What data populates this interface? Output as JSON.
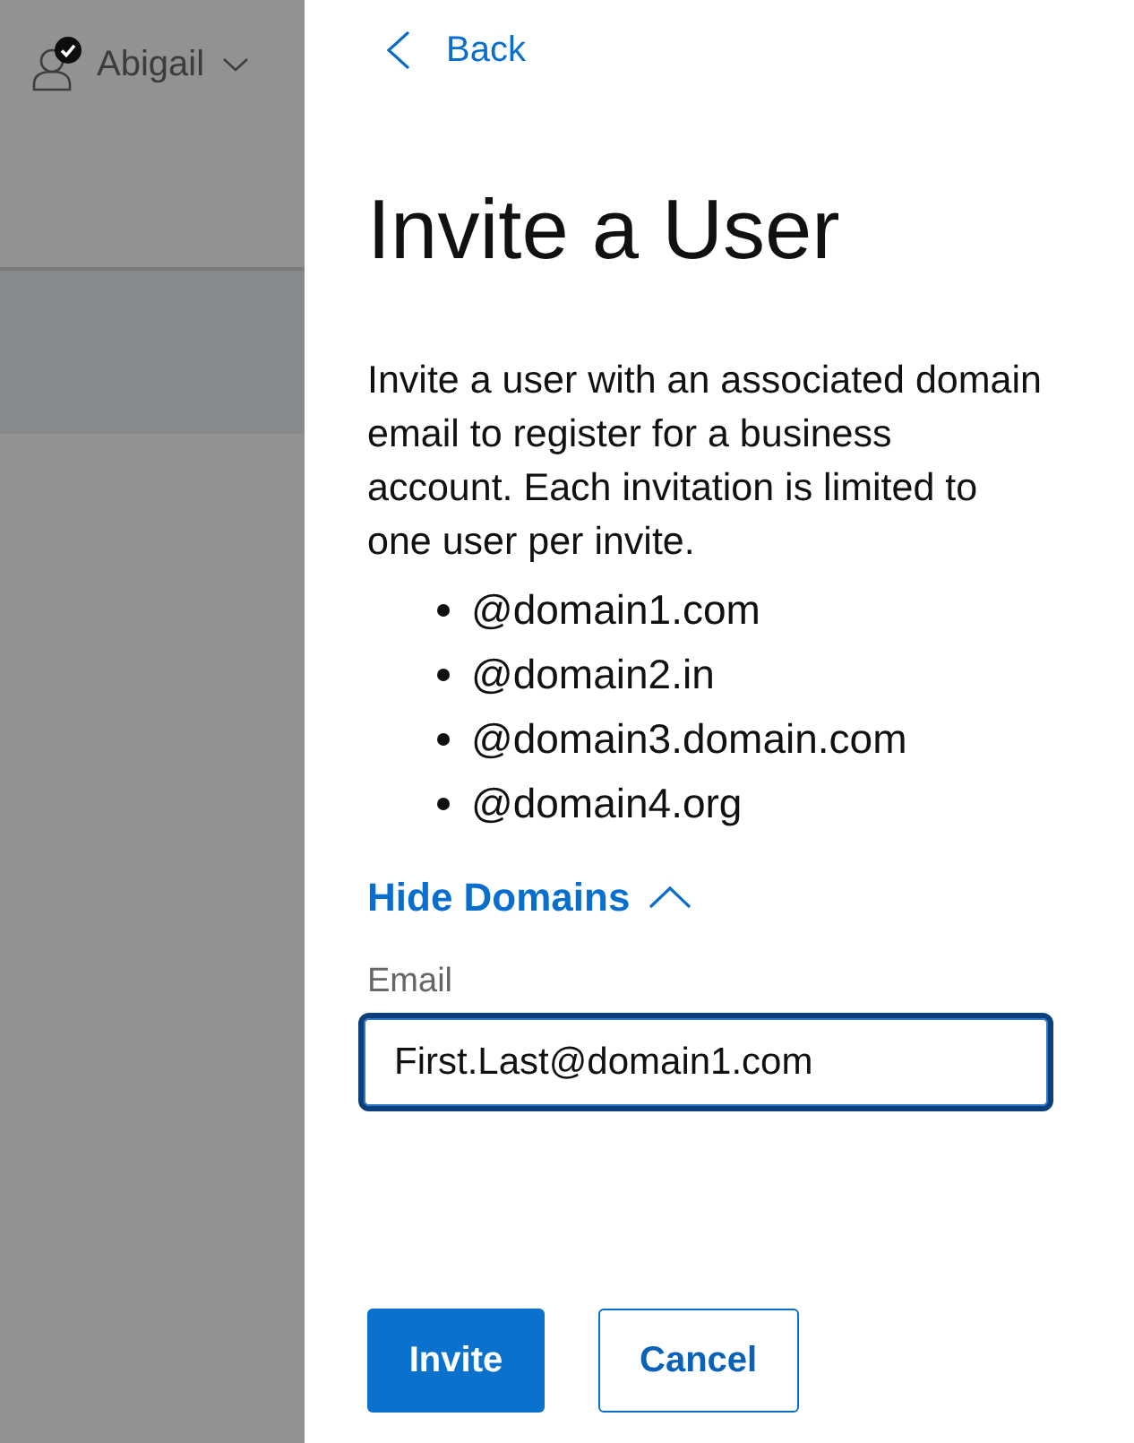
{
  "background_page": {
    "user_menu": {
      "name": "Abigail"
    }
  },
  "panel": {
    "back_link": "Back",
    "title": "Invite a User",
    "description": "Invite a user with an associated domain email to register for a business account. Each invitation is limited to one user per invite.",
    "domains": [
      "@domain1.com",
      "@domain2.in",
      "@domain3.domain.com",
      "@domain4.org"
    ],
    "domains_toggle": {
      "label": "Hide Domains",
      "expanded": true
    },
    "email_field": {
      "label": "Email",
      "value": "First.Last@domain1.com",
      "focused": true
    },
    "buttons": [
      {
        "label": "Invite",
        "kind": "primary"
      },
      {
        "label": "Cancel",
        "kind": "secondary"
      }
    ]
  }
}
